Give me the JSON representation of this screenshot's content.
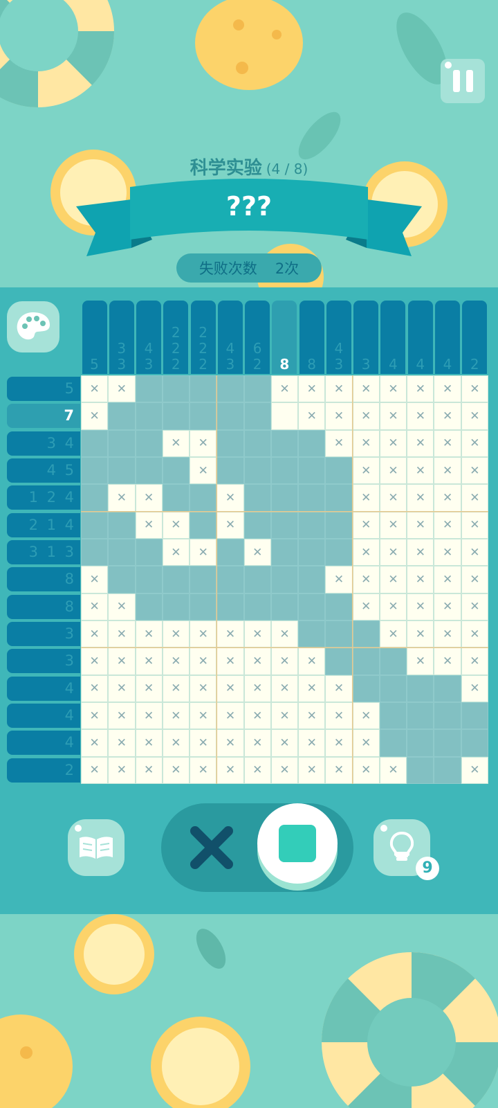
{
  "header": {
    "level_name": "科学实验",
    "level_progress": "(4 / 8)",
    "puzzle_title": "???",
    "fail_label": "失败次数",
    "fail_count": "2次"
  },
  "column_clues": [
    [
      "5"
    ],
    [
      "3",
      "3"
    ],
    [
      "4",
      "3"
    ],
    [
      "2",
      "2",
      "2"
    ],
    [
      "2",
      "2",
      "2"
    ],
    [
      "4",
      "3"
    ],
    [
      "6",
      "2"
    ],
    [
      "8"
    ],
    [
      "8"
    ],
    [
      "4",
      "3"
    ],
    [
      "3"
    ],
    [
      "4"
    ],
    [
      "4"
    ],
    [
      "4"
    ],
    [
      "2"
    ]
  ],
  "column_done": [
    false,
    false,
    false,
    false,
    false,
    false,
    false,
    true,
    false,
    false,
    false,
    false,
    false,
    false,
    false
  ],
  "row_clues": [
    "5",
    "7",
    "3 4",
    "4 5",
    "1 2 4",
    "2 1 4",
    "3 1 3",
    "8",
    "8",
    "3",
    "3",
    "4",
    "4",
    "4",
    "2"
  ],
  "row_done": [
    false,
    true,
    false,
    false,
    false,
    false,
    false,
    false,
    false,
    false,
    false,
    false,
    false,
    false,
    false
  ],
  "grid": [
    "XX..XXXXXXXXXXX",
    "X.......XXXXXXX",
    ".........XXXXXX",
    ".........XXXXXX",
    ".........XXXXXX",
    "......................",
    "...............",
    "...............",
    "...............",
    "...............",
    "...............",
    "...............",
    "...............",
    "...............",
    "..............."
  ],
  "cells": [
    "XX___..XXXXXXXX",
    "X____._~XXXXXXX",
    "___XX____XXXXXX",
    "____X_____XXXXX",
    "_XX__X____XXXXX",
    "__XX_X____XXXXX",
    "___XX_X___XXXXX",
    "X________XXXXXX",
    "XX________XXXXX",
    "XXXXXXXX___XXXX",
    "XXXXXXXXX___XXX",
    "XXXXXXXXXX____X",
    "XXXXXXXXXXX____",
    "XXXXXXXXXXX____",
    "XXXXXXXXXXXX__X"
  ],
  "controls": {
    "hint_count": "9"
  },
  "colors": {
    "background": "#7dd4c6",
    "panel": "#3fb7b9",
    "clue": "#0a7ea4",
    "filled_cell": "#82c0c2",
    "empty_cell": "#fffff0",
    "fill_mode": "#33cdb9"
  },
  "icons": {
    "palette": "palette-icon",
    "pause": "pause-icon",
    "book": "book-icon",
    "hint": "lightbulb-icon",
    "cross_mode": "cross-icon",
    "fill_mode": "square-icon"
  }
}
